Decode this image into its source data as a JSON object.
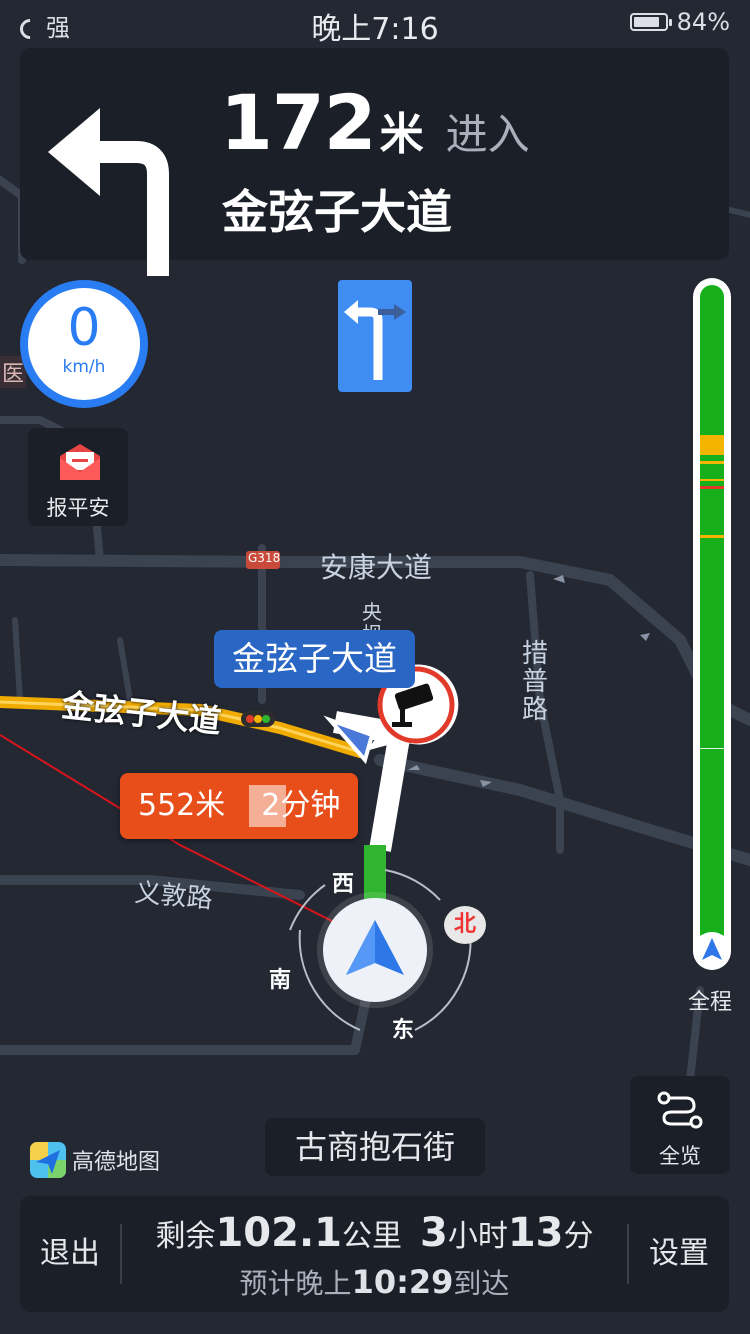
{
  "status_bar": {
    "signal": "强",
    "time": "晚上7:16",
    "battery_percent": "84%",
    "battery_level": 0.84
  },
  "guidance": {
    "distance": "172",
    "distance_unit": "米",
    "action": "进入",
    "road": "金弦子大道"
  },
  "speed": {
    "value": "0",
    "unit": "km/h"
  },
  "report_safe": {
    "label": "报平安"
  },
  "traffic_bar": {
    "label": "全程",
    "colors": {
      "smooth": "#17b01c",
      "slow": "#f5b400",
      "jam": "#e23a2a"
    }
  },
  "map": {
    "labels": {
      "hospital_fragment": "医",
      "highway_badge": "G318",
      "ankang_road": "安康大道",
      "yang_road": "央",
      "yang_road_2": "坝",
      "cuopu_road": "措普路",
      "jinxianzi_road": "金弦子大道",
      "yidun_road": "义敦路"
    },
    "callout_road": "金弦子大道",
    "route_info": {
      "distance": "552米",
      "time": "2分钟"
    },
    "compass": {
      "west": "西",
      "south": "南",
      "east": "东",
      "north": "北"
    }
  },
  "brand": {
    "name": "高德地图"
  },
  "current_street": "古商抱石街",
  "overview_button": {
    "label": "全览"
  },
  "bottom_bar": {
    "exit": "退出",
    "settings": "设置",
    "remaining_prefix": "剩余",
    "remaining_distance": "102.1",
    "remaining_unit": "公里",
    "remaining_hours": "3",
    "hours_unit": "小时",
    "remaining_minutes": "13",
    "minutes_unit": "分",
    "eta_prefix": "预计晚上",
    "eta_time": "10:29",
    "eta_suffix": "到达"
  }
}
